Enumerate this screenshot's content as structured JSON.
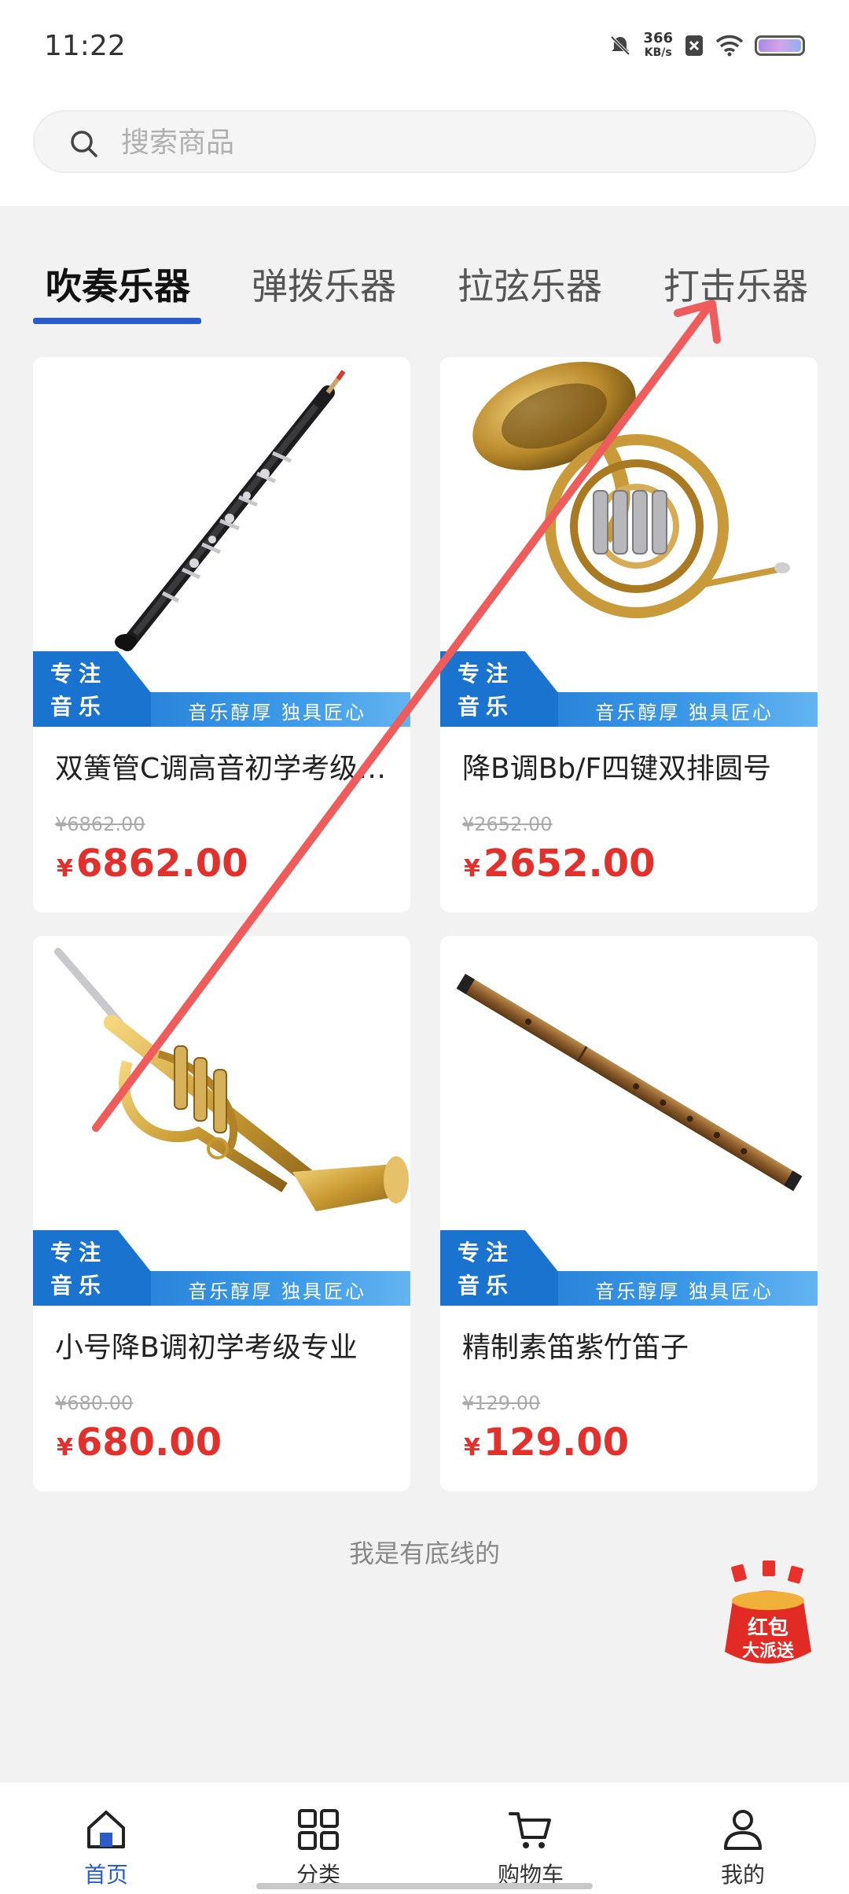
{
  "status_bar": {
    "time": "11:22",
    "speed_value": "366",
    "speed_unit": "KB/s"
  },
  "search": {
    "placeholder": "搜索商品"
  },
  "tabs": [
    {
      "label": "吹奏乐器",
      "active": true
    },
    {
      "label": "弹拨乐器",
      "active": false
    },
    {
      "label": "拉弦乐器",
      "active": false
    },
    {
      "label": "打击乐器",
      "active": false
    }
  ],
  "banner": {
    "tag_line1": "专注",
    "tag_line2": "音乐",
    "slogan": "音乐醇厚 独具匠心"
  },
  "products": [
    {
      "title": "双簧管C调高音初学考级专业",
      "original_price": "¥6862.00",
      "currency": "¥",
      "price": "6862.00",
      "image": "oboe"
    },
    {
      "title": "降B调Bb/F四键双排圆号",
      "original_price": "¥2652.00",
      "currency": "¥",
      "price": "2652.00",
      "image": "french-horn"
    },
    {
      "title": "小号降B调初学考级专业",
      "original_price": "¥680.00",
      "currency": "¥",
      "price": "680.00",
      "image": "trumpet"
    },
    {
      "title": "精制素笛紫竹笛子",
      "original_price": "¥129.00",
      "currency": "¥",
      "price": "129.00",
      "image": "bamboo-flute"
    }
  ],
  "footer_note": "我是有底线的",
  "promo": {
    "line1": "红包",
    "line2": "大派送"
  },
  "bottom_nav": [
    {
      "label": "首页",
      "icon": "home-icon",
      "active": true
    },
    {
      "label": "分类",
      "icon": "grid-icon",
      "active": false
    },
    {
      "label": "购物车",
      "icon": "cart-icon",
      "active": false
    },
    {
      "label": "我的",
      "icon": "user-icon",
      "active": false
    }
  ],
  "colors": {
    "accent": "#2a5ccc",
    "price": "#e2312d",
    "banner_blue": "#1b73d0"
  }
}
